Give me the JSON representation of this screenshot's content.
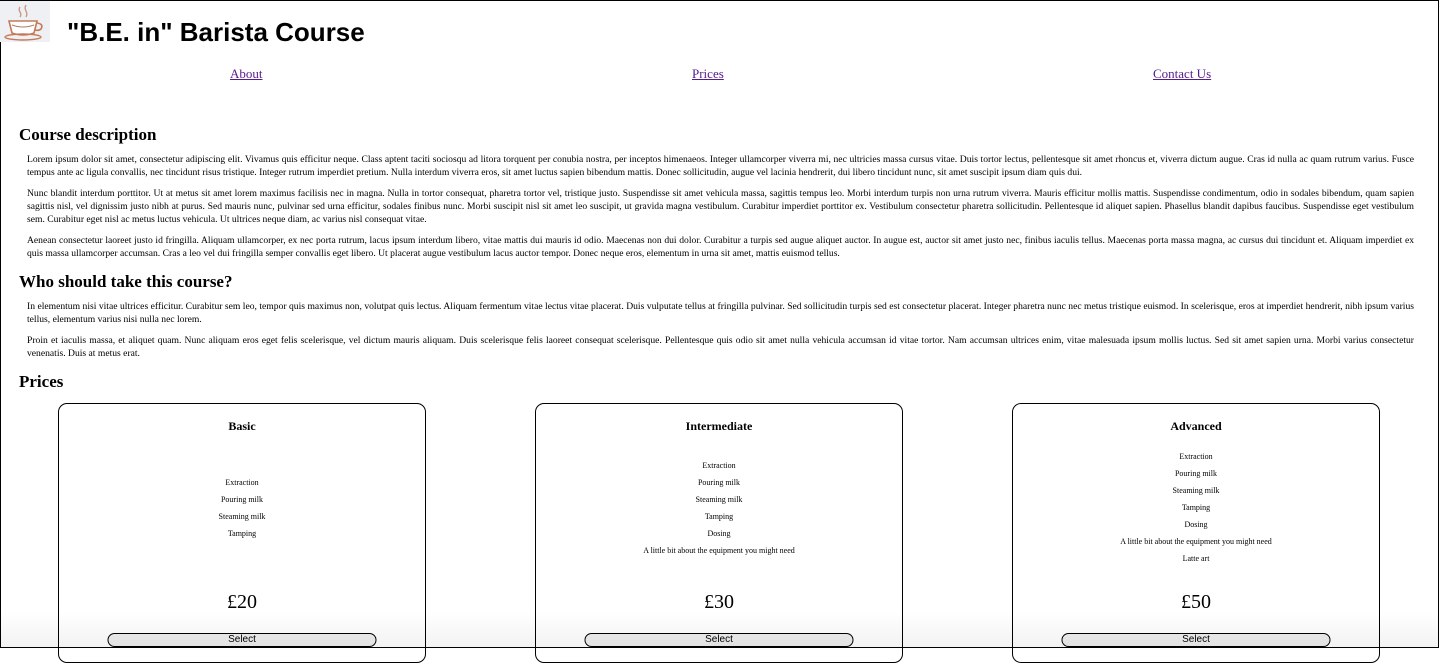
{
  "header": {
    "title": "\"B.E. in\" Barista Course",
    "logo_icon": "coffee-cup-icon"
  },
  "nav": {
    "items": [
      {
        "label": "About"
      },
      {
        "label": "Prices"
      },
      {
        "label": "Contact Us"
      }
    ]
  },
  "course_description": {
    "heading": "Course description",
    "paragraphs": [
      "Lorem ipsum dolor sit amet, consectetur adipiscing elit. Vivamus quis efficitur neque. Class aptent taciti sociosqu ad litora torquent per conubia nostra, per inceptos himenaeos. Integer ullamcorper viverra mi, nec ultricies massa cursus vitae. Duis tortor lectus, pellentesque sit amet rhoncus et, viverra dictum augue. Cras id nulla ac quam rutrum varius. Fusce tempus ante ac ligula convallis, nec tincidunt risus tristique. Integer rutrum imperdiet pretium. Nulla interdum viverra eros, sit amet luctus sapien bibendum mattis. Donec sollicitudin, augue vel lacinia hendrerit, dui libero tincidunt nunc, sit amet suscipit ipsum diam quis dui.",
      "Nunc blandit interdum porttitor. Ut at metus sit amet lorem maximus facilisis nec in magna. Nulla in tortor consequat, pharetra tortor vel, tristique justo. Suspendisse sit amet vehicula massa, sagittis tempus leo. Morbi interdum turpis non urna rutrum viverra. Mauris efficitur mollis mattis. Suspendisse condimentum, odio in sodales bibendum, quam sapien sagittis nisl, vel dignissim justo nibh at purus. Sed mauris nunc, pulvinar sed urna efficitur, sodales finibus nunc. Morbi suscipit nisl sit amet leo suscipit, ut gravida magna vestibulum. Curabitur imperdiet porttitor ex. Vestibulum consectetur pharetra sollicitudin. Pellentesque id aliquet sapien. Phasellus blandit dapibus faucibus. Suspendisse eget vestibulum sem. Curabitur eget nisl ac metus luctus vehicula. Ut ultrices neque diam, ac varius nisl consequat vitae.",
      "Aenean consectetur laoreet justo id fringilla. Aliquam ullamcorper, ex nec porta rutrum, lacus ipsum interdum libero, vitae mattis dui mauris id odio. Maecenas non dui dolor. Curabitur a turpis sed augue aliquet auctor. In augue est, auctor sit amet justo nec, finibus iaculis tellus. Maecenas porta massa magna, ac cursus dui tincidunt et. Aliquam imperdiet ex quis massa ullamcorper accumsan. Cras a leo vel dui fringilla semper convallis eget libero. Ut placerat augue vestibulum lacus auctor tempor. Donec neque eros, elementum in urna sit amet, mattis euismod tellus."
    ]
  },
  "audience": {
    "heading": "Who should take this course?",
    "paragraphs": [
      "In elementum nisi vitae ultrices efficitur. Curabitur sem leo, tempor quis maximus non, volutpat quis lectus. Aliquam fermentum vitae lectus vitae placerat. Duis vulputate tellus at fringilla pulvinar. Sed sollicitudin turpis sed est consectetur placerat. Integer pharetra nunc nec metus tristique euismod. In scelerisque, eros at imperdiet hendrerit, nibh ipsum varius tellus, elementum varius nisi nulla nec lorem.",
      "Proin et iaculis massa, et aliquet quam. Nunc aliquam eros eget felis scelerisque, vel dictum mauris aliquam. Duis scelerisque felis laoreet consequat scelerisque. Pellentesque quis odio sit amet nulla vehicula accumsan id vitae tortor. Nam accumsan ultrices enim, vitae malesuada ipsum mollis luctus. Sed sit amet sapien urna. Morbi varius consectetur venenatis. Duis at metus erat."
    ]
  },
  "prices": {
    "heading": "Prices",
    "cards": [
      {
        "title": "Basic",
        "features": [
          "Extraction",
          "Pouring milk",
          "Steaming milk",
          "Tamping"
        ],
        "price": "£20",
        "button_label": "Select"
      },
      {
        "title": "Intermediate",
        "features": [
          "Extraction",
          "Pouring milk",
          "Steaming milk",
          "Tamping",
          "Dosing",
          "A little bit about the equipment you might need"
        ],
        "price": "£30",
        "button_label": "Select"
      },
      {
        "title": "Advanced",
        "features": [
          "Extraction",
          "Pouring milk",
          "Steaming milk",
          "Tamping",
          "Dosing",
          "A little bit about the equipment you might need",
          "Latte art"
        ],
        "price": "£50",
        "button_label": "Select"
      }
    ]
  },
  "colors": {
    "link": "#0000ee",
    "link_visited": "#551a8b",
    "button_bg": "#eeeeee",
    "border": "#000000"
  }
}
